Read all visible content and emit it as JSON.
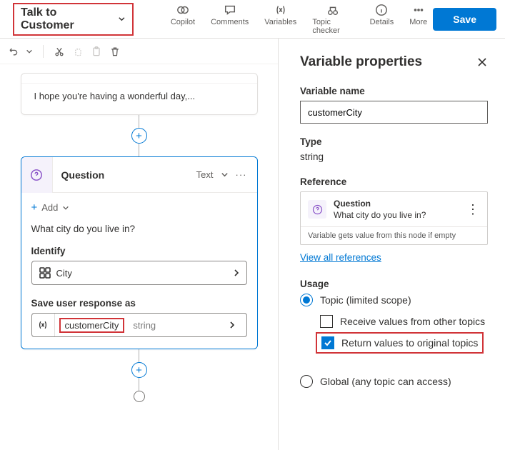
{
  "header": {
    "topic_name": "Talk to Customer",
    "tools": {
      "copilot": "Copilot",
      "comments": "Comments",
      "variables": "Variables",
      "topic_checker": "Topic checker",
      "details": "Details",
      "more": "More"
    },
    "save_label": "Save"
  },
  "canvas": {
    "message_text": "I hope you're having a wonderful day,...",
    "question": {
      "title": "Question",
      "type_tag": "Text",
      "add_label": "Add",
      "prompt": "What city do you live in?",
      "identify_label": "Identify",
      "identify_value": "City",
      "save_as_label": "Save user response as",
      "var_name": "customerCity",
      "var_type": "string"
    }
  },
  "panel": {
    "title": "Variable properties",
    "name_label": "Variable name",
    "name_value": "customerCity",
    "type_label": "Type",
    "type_value": "string",
    "reference_label": "Reference",
    "ref_title": "Question",
    "ref_sub": "What city do you live in?",
    "ref_note": "Variable gets value from this node if empty",
    "view_all": "View all references",
    "usage_label": "Usage",
    "topic_scope": "Topic (limited scope)",
    "receive_label": "Receive values from other topics",
    "return_label": "Return values to original topics",
    "global_label": "Global (any topic can access)"
  }
}
